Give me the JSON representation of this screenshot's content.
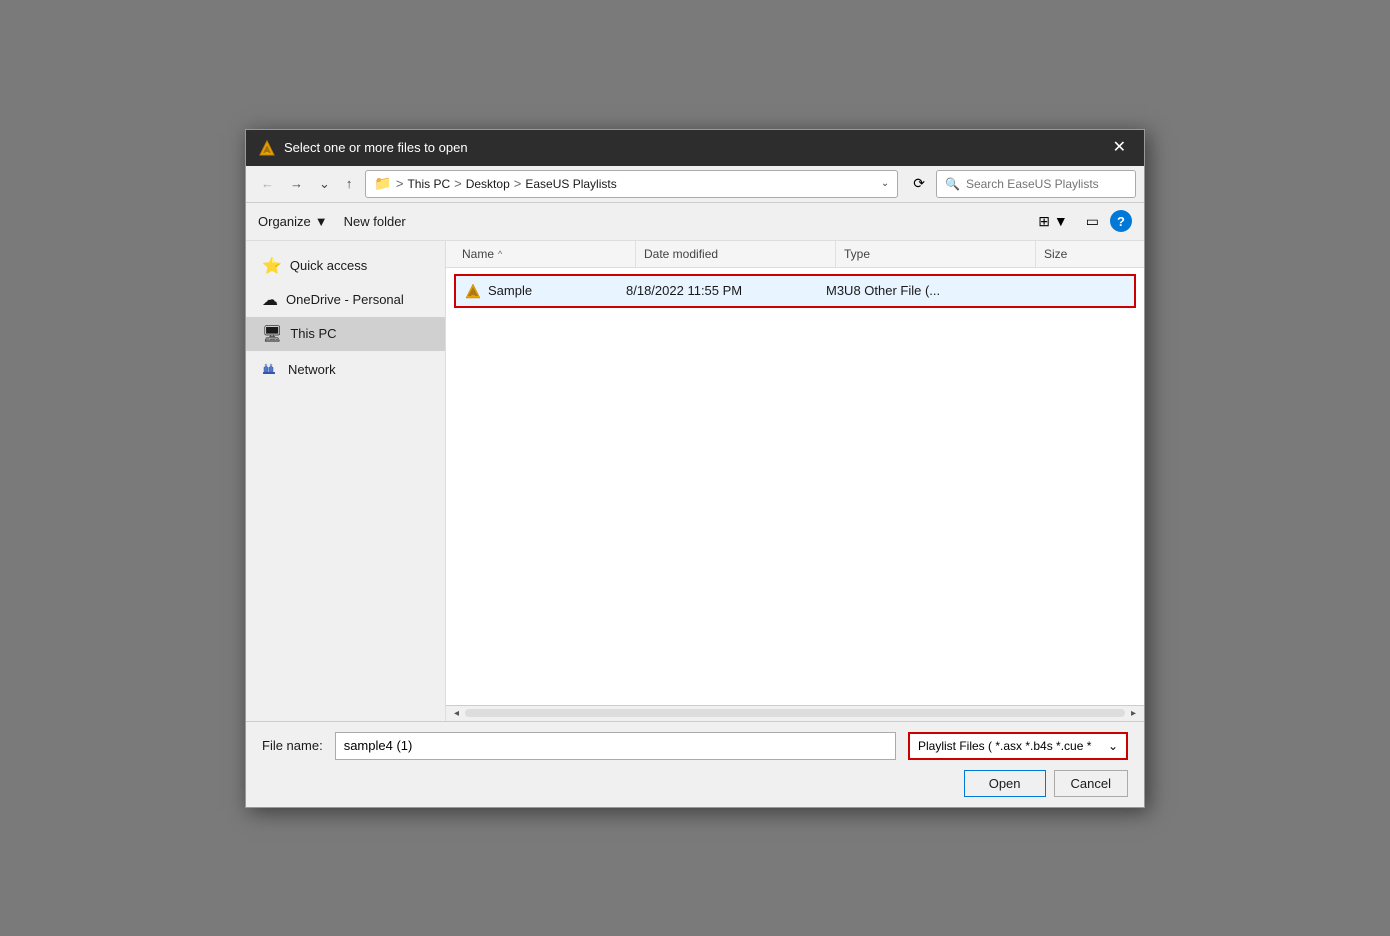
{
  "dialog": {
    "title": "Select one or more files to open",
    "close_label": "✕"
  },
  "toolbar": {
    "back_label": "←",
    "forward_label": "→",
    "dropdown_label": "⌄",
    "up_label": "↑",
    "refresh_label": "⟳",
    "breadcrumb": {
      "icon": "📁",
      "path": [
        "This PC",
        "Desktop",
        "EaseUS Playlists"
      ],
      "separator": "›"
    },
    "search_placeholder": "Search EaseUS Playlists",
    "search_icon": "🔍"
  },
  "options_bar": {
    "organize_label": "Organize",
    "organize_arrow": "▼",
    "new_folder_label": "New folder",
    "view_icon_label": "⊞",
    "view_dropdown": "▼",
    "pane_icon_label": "▭",
    "help_label": "?"
  },
  "sidebar": {
    "items": [
      {
        "id": "quick-access",
        "label": "Quick access",
        "icon": "⭐"
      },
      {
        "id": "onedrive",
        "label": "OneDrive - Personal",
        "icon": "☁"
      },
      {
        "id": "this-pc",
        "label": "This PC",
        "icon": "🖥"
      },
      {
        "id": "network",
        "label": "Network",
        "icon": "🖧"
      }
    ],
    "selected": "this-pc"
  },
  "file_list": {
    "columns": [
      {
        "id": "name",
        "label": "Name",
        "sort_arrow": "^"
      },
      {
        "id": "date",
        "label": "Date modified"
      },
      {
        "id": "type",
        "label": "Type"
      },
      {
        "id": "size",
        "label": "Size"
      }
    ],
    "files": [
      {
        "name": "Sample",
        "date_modified": "8/18/2022 11:55 PM",
        "type": "M3U8 Other File (...",
        "size": "",
        "selected": true
      }
    ]
  },
  "bottom": {
    "filename_label": "File name:",
    "filename_value": "sample4 (1)",
    "filetype_value": "Playlist Files ( *.asx *.b4s *.cue *",
    "filetype_arrow": "⌄",
    "open_label": "Open",
    "cancel_label": "Cancel"
  },
  "scrollbar": {
    "left_arrow": "◂",
    "right_arrow": "▸"
  }
}
